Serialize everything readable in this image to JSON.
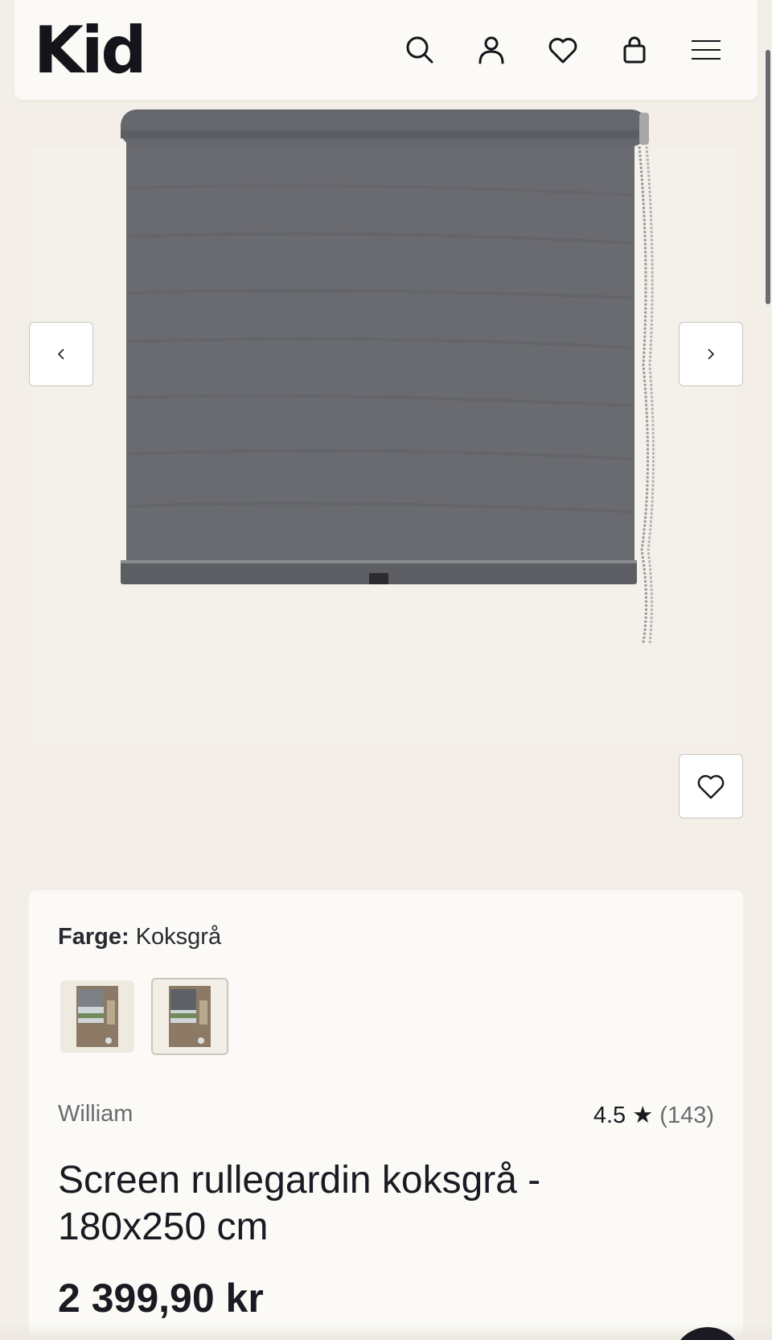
{
  "header": {
    "logo": "Kid",
    "icons": [
      "search-icon",
      "user-icon",
      "heart-icon",
      "bag-icon",
      "menu-icon"
    ]
  },
  "gallery": {
    "prev_icon": "chevron-left-icon",
    "next_icon": "chevron-right-icon",
    "favorite_icon": "heart-icon",
    "blind_color": "#6a6b70"
  },
  "product": {
    "color_label": "Farge:",
    "color_value": "Koksgrå",
    "swatches": [
      "swatch-1",
      "swatch-2"
    ],
    "brand": "William",
    "rating": "4.5",
    "rating_star": "★",
    "review_count": "(143)",
    "title": "Screen rullegardin koksgrå - 180x250 cm",
    "price": "2 399,90 kr"
  },
  "colors": {
    "background": "#f3efe8",
    "card": "#fbfaf6",
    "text": "#1b1a22",
    "muted": "#6b6a70"
  }
}
